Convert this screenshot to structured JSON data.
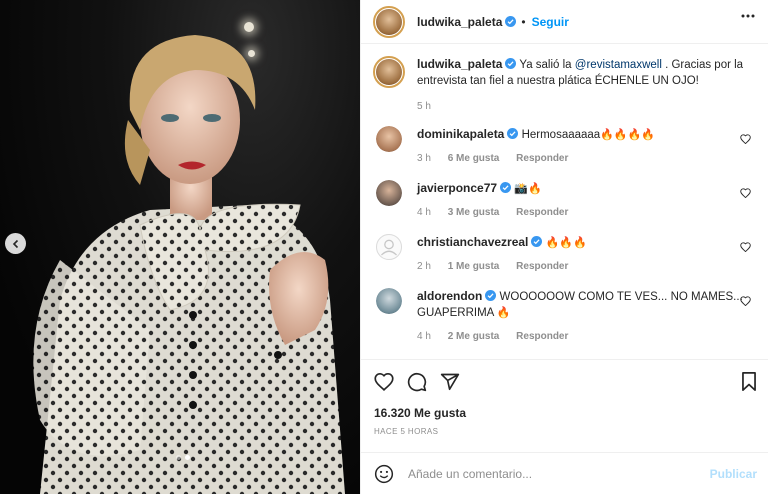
{
  "post": {
    "username": "ludwika_paleta",
    "follow_label": "Seguir",
    "separator": "•",
    "caption_user": "ludwika_paleta",
    "caption_pre": "Ya salió la",
    "caption_mention": "@revistamaxwell",
    "caption_post": ". Gracias por la entrevista tan fiel a nuestra plática ÉCHENLE UN OJO!",
    "caption_time": "5 h"
  },
  "comments": [
    {
      "user": "dominikapaleta",
      "text": "Hermosaaaaaa",
      "emoji": "🔥🔥🔥🔥",
      "time": "3 h",
      "likes": "6 Me gusta",
      "reply": "Responder",
      "verified": true
    },
    {
      "user": "javierponce77",
      "text": "",
      "emoji": "📸🔥",
      "time": "4 h",
      "likes": "3 Me gusta",
      "reply": "Responder",
      "verified": true
    },
    {
      "user": "christianchavezreal",
      "text": "",
      "emoji": "🔥🔥🔥",
      "time": "2 h",
      "likes": "1 Me gusta",
      "reply": "Responder",
      "verified": true
    },
    {
      "user": "aldorendon",
      "text": "WOOOOOOW COMO TE VES... NO MAMES... GUAPERRIMA",
      "emoji": "🔥",
      "time": "4 h",
      "likes": "2 Me gusta",
      "reply": "Responder",
      "verified": true
    }
  ],
  "stats": {
    "likes": "16.320 Me gusta",
    "ago": "HACE 5 HORAS"
  },
  "composer": {
    "placeholder": "Añade un comentario...",
    "publish_label": "Publicar"
  },
  "icons": {
    "more": "more-options-icon",
    "like": "heart-icon",
    "comment": "comment-icon",
    "share": "share-icon",
    "save": "bookmark-icon",
    "emoji": "emoji-icon",
    "prev": "chevron-left-icon"
  },
  "colors": {
    "accent": "#0095f6",
    "mention": "#00376b",
    "muted": "#8e8e8e",
    "publish_disabled": "#b2dffc"
  }
}
